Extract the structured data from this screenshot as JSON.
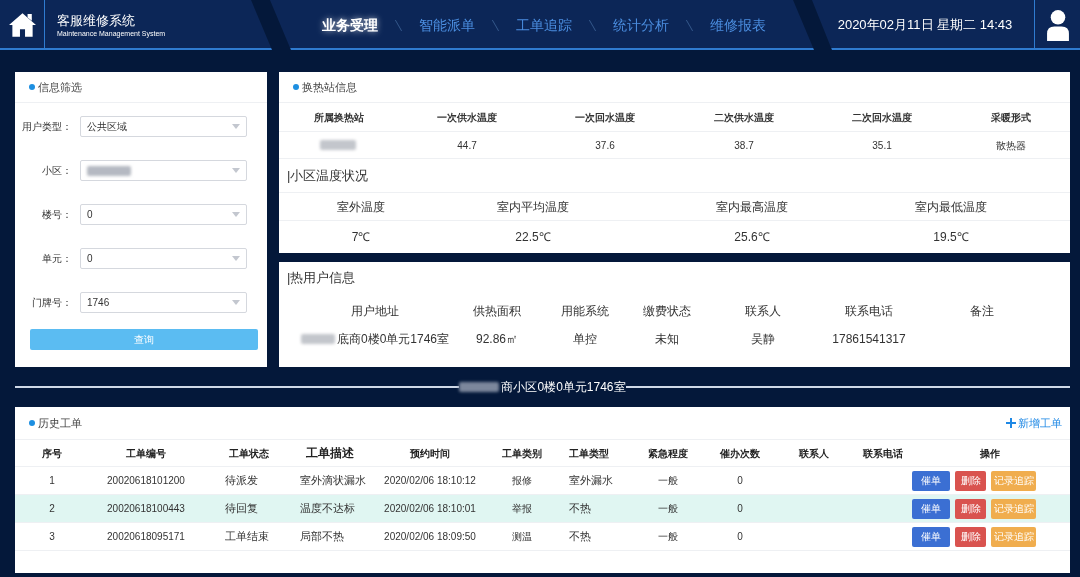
{
  "header": {
    "title": "客服维修系统",
    "subtitle": "Maintenance Management System",
    "nav": [
      {
        "label": "业务受理",
        "selected": true
      },
      {
        "label": "智能派单",
        "selected": false
      },
      {
        "label": "工单追踪",
        "selected": false
      },
      {
        "label": "统计分析",
        "selected": false
      },
      {
        "label": "维修报表",
        "selected": false
      }
    ],
    "datetime": "2020年02月11日 星期二 14:43"
  },
  "filter_panel": {
    "title": "信息筛选",
    "fields": [
      {
        "label": "用户类型：",
        "value": "公共区域"
      },
      {
        "label": "小区：",
        "blurred": true
      },
      {
        "label": "楼号：",
        "value": "0"
      },
      {
        "label": "单元：",
        "value": "0"
      },
      {
        "label": "门牌号：",
        "value": "1746"
      }
    ],
    "button": "查询"
  },
  "station_panel": {
    "title": "换热站信息",
    "columns": [
      "所属换热站",
      "一次供水温度",
      "一次回水温度",
      "二次供水温度",
      "二次回水温度",
      "采暖形式"
    ],
    "row": [
      {
        "blurred": true
      },
      {
        "text": "44.7"
      },
      {
        "text": "37.6"
      },
      {
        "text": "38.7"
      },
      {
        "text": "35.1"
      },
      {
        "text": "散热器"
      }
    ],
    "temperature": {
      "title": "|小区温度状况",
      "columns": [
        "室外温度",
        "室内平均温度",
        "室内最高温度",
        "室内最低温度"
      ],
      "values": [
        "7℃",
        "22.5℃",
        "25.6℃",
        "19.5℃"
      ]
    }
  },
  "user_panel": {
    "title": "|热用户信息",
    "columns": [
      "用户地址",
      "供热面积",
      "用能系统",
      "缴费状态",
      "联系人",
      "联系电话",
      "备注"
    ],
    "row": [
      {
        "text": "底商0楼0单元1746室",
        "blurred": true
      },
      {
        "text": "92.86㎡"
      },
      {
        "text": "单控"
      },
      {
        "text": "未知"
      },
      {
        "text": "吴静"
      },
      {
        "text": "17861541317"
      }
    ]
  },
  "location_title": {
    "text": "商小区0楼0单元1746室",
    "blurred": true
  },
  "orders_panel": {
    "title": "历史工单",
    "add_button": "新增工单",
    "columns": [
      "序号",
      "工单编号",
      "工单状态",
      "工单描述",
      "预约时间",
      "工单类别",
      "工单类型",
      "紧急程度",
      "催办次数",
      "联系人",
      "联系电话",
      "操作"
    ],
    "rows": [
      {
        "selected": false,
        "cells": [
          "1",
          "20020618101200",
          "待派发",
          "室外滴状漏水",
          "2020/02/06 18:10:12",
          "报修",
          "室外漏水",
          "一般",
          "0"
        ],
        "actions": [
          {
            "label": "催单",
            "kind": "primary"
          },
          {
            "label": "删除",
            "kind": "danger"
          },
          {
            "label": "记录追踪",
            "kind": "warning"
          }
        ]
      },
      {
        "selected": true,
        "cells": [
          "2",
          "20020618100443",
          "待回复",
          "温度不达标",
          "2020/02/06 18:10:01",
          "举报",
          "不热",
          "一般",
          "0"
        ],
        "actions": [
          {
            "label": "催单",
            "kind": "primary"
          },
          {
            "label": "删除",
            "kind": "danger"
          },
          {
            "label": "记录追踪",
            "kind": "warning"
          }
        ]
      },
      {
        "selected": false,
        "cells": [
          "3",
          "20020618095171",
          "工单结束",
          "局部不热",
          "2020/02/06 18:09:50",
          "测温",
          "不热",
          "一般",
          "0"
        ],
        "actions": [
          {
            "label": "催单",
            "kind": "primary"
          },
          {
            "label": "删除",
            "kind": "danger"
          },
          {
            "label": "记录追踪",
            "kind": "warning"
          }
        ]
      }
    ]
  }
}
